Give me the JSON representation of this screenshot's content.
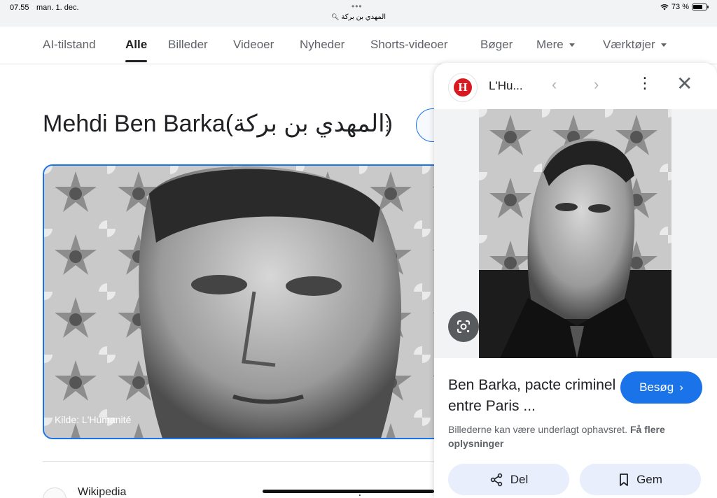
{
  "status_bar": {
    "time": "07.55",
    "date": "man. 1. dec.",
    "url": "المهدي بن بركة",
    "battery": "73 %",
    "battery_level": 0.73
  },
  "tabs": [
    {
      "label": "AI-tilstand",
      "active": false
    },
    {
      "label": "Alle",
      "active": true
    },
    {
      "label": "Billeder",
      "active": false
    },
    {
      "label": "Videoer",
      "active": false
    },
    {
      "label": "Nyheder",
      "active": false
    },
    {
      "label": "Shorts-videoer",
      "active": false
    },
    {
      "label": "Bøger",
      "active": false
    },
    {
      "label": "Mere",
      "active": false,
      "dropdown": true
    },
    {
      "label": "Værktøjer",
      "active": false,
      "dropdown": true
    }
  ],
  "main": {
    "title": "Mehdi Ben Barka(المهدي بن بركة)",
    "hero_caption": "Kilde: L'Humanité",
    "result_source": "Wikipedia"
  },
  "panel": {
    "source": "L'Hu...",
    "logo_letter": "H",
    "title": "Ben Barka, pacte criminel entre Paris ...",
    "visit_label": "Besøg",
    "copyright_text": "Billederne kan være underlagt ophavsret.",
    "copyright_link": "Få flere oplysninger",
    "share_label": "Del",
    "save_label": "Gem"
  },
  "colors": {
    "accent": "#1a73e8",
    "logo_red": "#d71920",
    "pill_bg": "#e8eefb"
  }
}
